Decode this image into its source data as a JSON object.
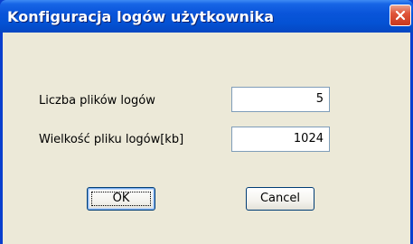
{
  "window": {
    "title": "Konfiguracja logów użytkownika",
    "close_icon": "close-icon"
  },
  "form": {
    "log_count_label": "Liczba plików logów",
    "log_count_value": "5",
    "log_size_label": "Wielkość pliku logów[kb]",
    "log_size_value": "1024"
  },
  "buttons": {
    "ok_label": "OK",
    "cancel_label": "Cancel"
  },
  "colors": {
    "titlebar": "#0a55da",
    "client_background": "#ece9d8",
    "close_button": "#e0553a"
  }
}
